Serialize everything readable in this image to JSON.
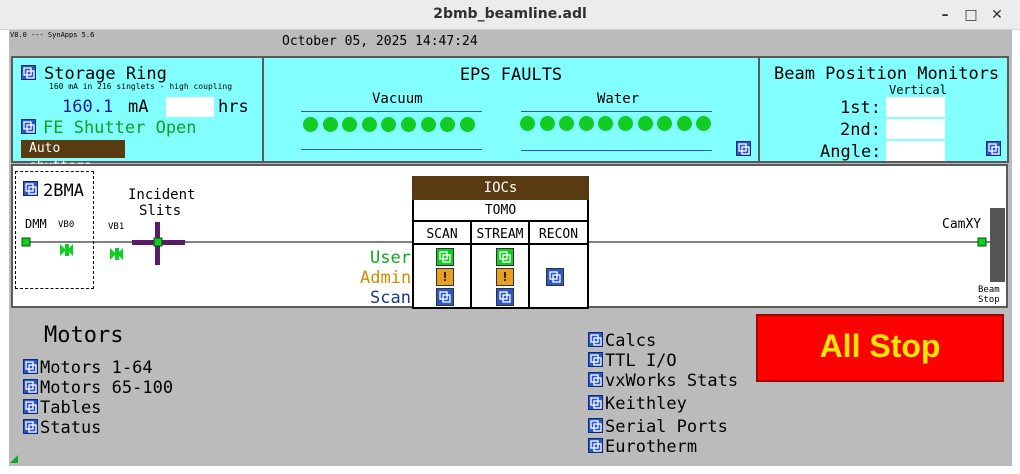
{
  "window": {
    "title": "2bmb_beamline.adl",
    "minimize": "–",
    "maximize": "□",
    "close": "✕"
  },
  "header": {
    "version": "V8.0 --- SynApps 5.6",
    "datetime": "October 05, 2025 14:47:24"
  },
  "storage_ring": {
    "title": "Storage Ring",
    "subtitle": "160 mA in 216 singlets - high coupling",
    "current": "160.1",
    "current_unit": "mA",
    "hrs_value": "",
    "hrs_label": "hrs",
    "fe_shutter": "FE Shutter Open",
    "auto_shutters": "Auto shutters"
  },
  "eps": {
    "title": "EPS FAULTS",
    "vacuum_label": "Vacuum",
    "water_label": "Water",
    "vacuum_count": 9,
    "water_count": 10,
    "ok_color": "#11cc22"
  },
  "bpm": {
    "title": "Beam Position Monitors",
    "vertical_label": "Vertical",
    "first_label": "1st:",
    "second_label": "2nd:",
    "angle_label": "Angle:",
    "first_value": "",
    "second_value": "",
    "angle_value": ""
  },
  "beamline": {
    "station": "2BMA",
    "dmm": "DMM",
    "vb0": "VB0",
    "vb1": "VB1",
    "slits_line1": "Incident",
    "slits_line2": "Slits",
    "camxy": "CamXY",
    "beam_stop_line1": "Beam",
    "beam_stop_line2": "Stop"
  },
  "iocs": {
    "title": "IOCs",
    "group": "TOMO",
    "columns": [
      "SCAN",
      "STREAM",
      "RECON"
    ],
    "rows": [
      {
        "label": "User",
        "color": "#11aa22"
      },
      {
        "label": "Admin",
        "color": "#d48a00"
      },
      {
        "label": "Scan",
        "color": "#1a3a8a"
      }
    ],
    "warn_glyph": "!"
  },
  "motors": {
    "title": "Motors",
    "items": [
      "Motors 1-64",
      "Motors 65-100",
      "Tables",
      "Status"
    ]
  },
  "tools": {
    "items": [
      "Calcs",
      "TTL I/O",
      "vxWorks Stats",
      "Keithley",
      "Serial Ports",
      "Eurotherm"
    ]
  },
  "allstop": {
    "label": "All Stop",
    "bg_color": "#fd0000",
    "text_color": "#f5e800"
  }
}
